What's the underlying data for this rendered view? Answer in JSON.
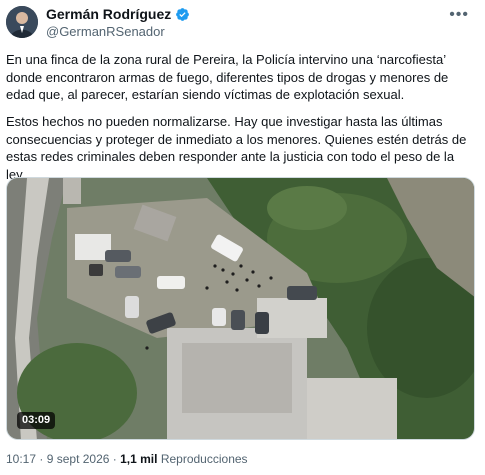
{
  "author": {
    "name": "Germán Rodríguez",
    "handle": "@GermanRSenador",
    "verified": true,
    "avatar_icon": "avatar-portrait"
  },
  "menu_icon": "more-options-icon",
  "tweet": {
    "paragraph1": "En una finca de la zona rural de Pereira, la Policía intervino una ‘narcofiesta’ donde encontraron armas de fuego, diferentes tipos de drogas y menores de edad que, al parecer, estarían siendo víctimas de explotación sexual.",
    "paragraph2": "Estos hechos no pueden normalizarse. Hay que investigar hasta las últimas consecuencias y proteger de inmediato a los menores. Quienes estén detrás de estas redes criminales deben responder ante la justicia con todo el peso de la ley."
  },
  "video": {
    "duration": "03:09"
  },
  "meta": {
    "time": "10:17",
    "separator": "·",
    "date": "9 sept 2026",
    "views": "1,1 mil",
    "views_label": "Reproducciones"
  },
  "colors": {
    "verified": "#1d9bf0",
    "muted_text": "#536471",
    "text": "#0f1419"
  }
}
